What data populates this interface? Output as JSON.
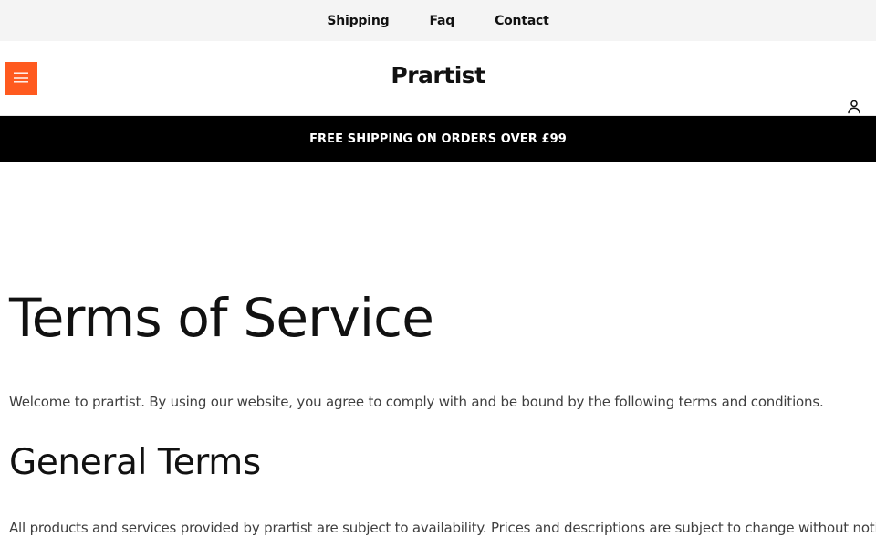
{
  "top_nav": {
    "links": [
      "Shipping",
      "Faq",
      "Contact"
    ]
  },
  "header": {
    "brand": "Prartist",
    "menu_icon": "hamburger-menu-icon",
    "account_icon": "user-icon",
    "accent_color": "#ff5a1f"
  },
  "announcement": {
    "text": "FREE SHIPPING ON ORDERS OVER £99"
  },
  "page": {
    "title": "Terms of Service",
    "intro": "Welcome to prartist. By using our website, you agree to comply with and be bound by the following terms and conditions.",
    "sections": [
      {
        "heading": "General Terms",
        "text": "All products and services provided by prartist are subject to availability. Prices and descriptions are subject to change without notice."
      }
    ]
  }
}
